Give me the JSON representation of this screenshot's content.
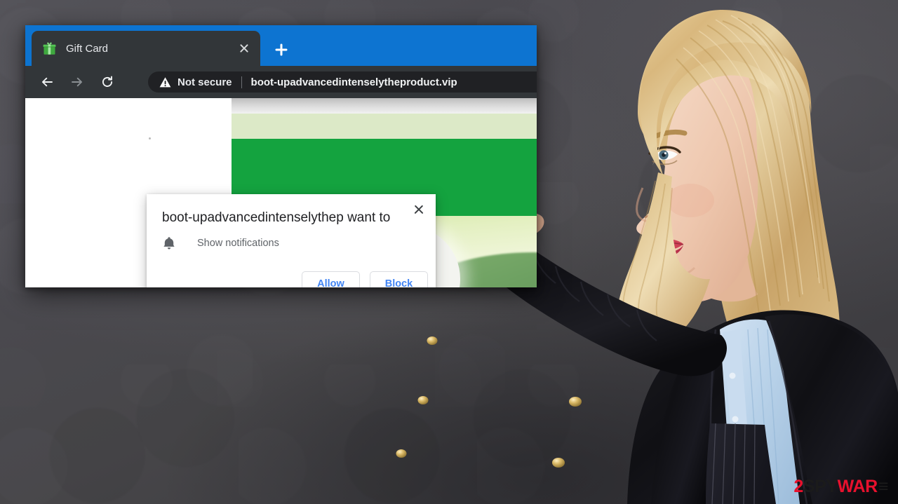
{
  "browser": {
    "tab": {
      "title": "Gift Card",
      "favicon_name": "gift-box-icon",
      "close_label": "×"
    },
    "new_tab_label": "+",
    "nav": {
      "back_label": "Back",
      "forward_label": "Forward",
      "reload_label": "Reload"
    },
    "omnibox": {
      "security_badge": "Not secure",
      "security_icon": "warning-triangle-icon",
      "url": "boot-upadvancedintenselytheproduct.vip"
    }
  },
  "permission_dialog": {
    "title": "boot-upadvancedintenselythep want to",
    "permission_icon": "bell-icon",
    "permission_label": "Show notifications",
    "allow_label": "Allow",
    "block_label": "Block",
    "close_label": "×"
  },
  "watermark": {
    "part1": "2",
    "part2": "SPY",
    "part3": "WAR",
    "part4": "≡"
  },
  "colors": {
    "tabstrip_blue": "#0d74d1",
    "chrome_dark": "#323639",
    "omnibox_dark": "#202124",
    "button_blue": "#4285f4",
    "page_green": "#14a33f",
    "page_light_green": "#dce9c7",
    "backdrop_grey": "#474747",
    "watermark_red": "#e8112d"
  }
}
